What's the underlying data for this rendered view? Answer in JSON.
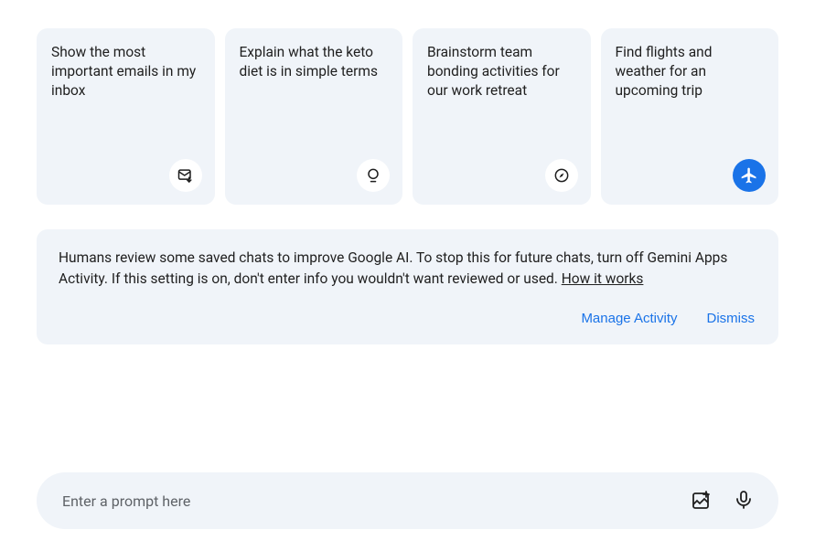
{
  "suggestions": [
    {
      "text": "Show the most important emails in my inbox",
      "icon": "email"
    },
    {
      "text": "Explain what the keto diet is in simple terms",
      "icon": "lightbulb"
    },
    {
      "text": "Brainstorm team bonding activities for our work retreat",
      "icon": "compass"
    },
    {
      "text": "Find flights and weather for an upcoming trip",
      "icon": "flight"
    }
  ],
  "notice": {
    "text": "Humans review some saved chats to improve Google AI. To stop this for future chats, turn off Gemini Apps Activity. If this setting is on, don't enter info you wouldn't want reviewed or used. ",
    "link_text": "How it works",
    "manage_label": "Manage Activity",
    "dismiss_label": "Dismiss"
  },
  "prompt": {
    "placeholder": "Enter a prompt here"
  },
  "colors": {
    "card_bg": "#f0f4f9",
    "accent": "#1a73e8",
    "text": "#1f1f1f"
  }
}
